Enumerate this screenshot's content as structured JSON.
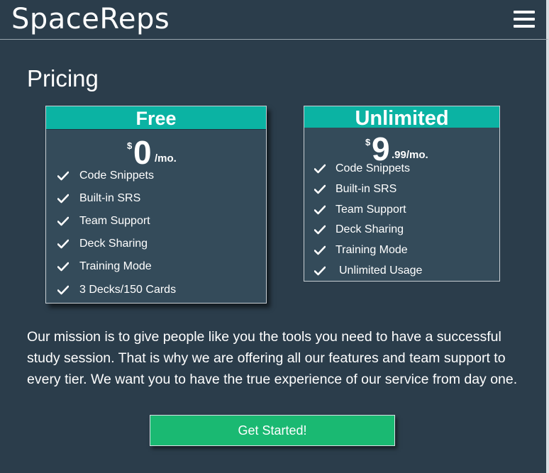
{
  "header": {
    "logo": "SpaceReps",
    "menu_icon": "hamburger-menu-icon"
  },
  "page": {
    "title": "Pricing"
  },
  "plans": [
    {
      "name": "Free",
      "currency": "$",
      "amount": "0",
      "period": "/mo.",
      "features": [
        "Code Snippets",
        "Built-in SRS",
        "Team Support",
        "Deck Sharing",
        "Training Mode",
        "3 Decks/150 Cards"
      ]
    },
    {
      "name": "Unlimited",
      "currency": "$",
      "amount": "9",
      "period": ".99/mo.",
      "features": [
        "Code Snippets",
        "Built-in SRS",
        "Team Support",
        "Deck Sharing",
        "Training Mode",
        "Unlimited Usage"
      ]
    }
  ],
  "mission": "Our mission is to give people like you the tools you need to have a successful study session. That is why we are offering all our features and team support to every tier. We want you to have the true experience of our service from day one.",
  "cta": {
    "label": "Get Started!"
  },
  "colors": {
    "background": "#2b3d4b",
    "card": "#344b5a",
    "accent": "#0bb3a3",
    "cta": "#1ab972"
  }
}
